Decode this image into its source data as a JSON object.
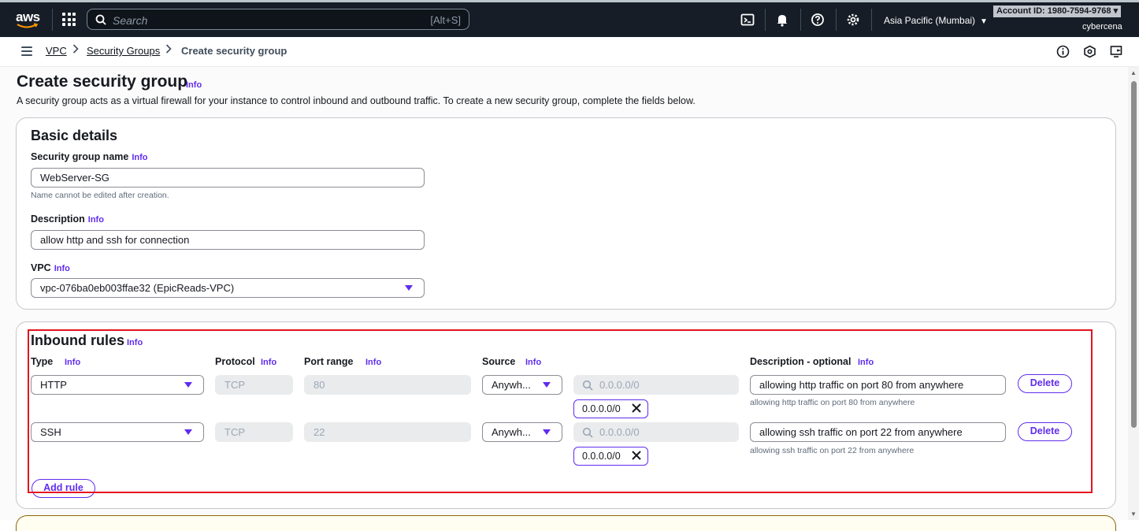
{
  "topnav": {
    "logo_text": "aws",
    "search_placeholder": "Search",
    "search_shortcut": "[Alt+S]",
    "region": "Asia Pacific (Mumbai)",
    "account": "Account ID: 1980-7594-9768 ▾",
    "user": "cybercena"
  },
  "breadcrumb": {
    "items": [
      "VPC",
      "Security Groups"
    ],
    "current": "Create security group"
  },
  "page": {
    "title": "Create security group",
    "info": "Info",
    "description": "A security group acts as a virtual firewall for your instance to control inbound and outbound traffic. To create a new security group, complete the fields below."
  },
  "basic": {
    "title": "Basic details",
    "name_label": "Security group name",
    "name_value": "WebServer-SG",
    "name_hint": "Name cannot be edited after creation.",
    "desc_label": "Description",
    "desc_value": "allow http and ssh for connection",
    "vpc_label": "VPC",
    "vpc_value": "vpc-076ba0eb003ffae32 (EpicReads-VPC)"
  },
  "inbound": {
    "title": "Inbound rules",
    "columns": {
      "type": "Type",
      "protocol": "Protocol",
      "port": "Port range",
      "source": "Source",
      "description": "Description - optional"
    },
    "rules": [
      {
        "type": "HTTP",
        "protocol": "TCP",
        "port": "80",
        "source": "Anywh...",
        "cidr_placeholder": "0.0.0.0/0",
        "token": "0.0.0.0/0",
        "description": "allowing http traffic on port 80 from anywhere",
        "description_hint": "allowing http traffic on port 80 from anywhere",
        "delete_label": "Delete"
      },
      {
        "type": "SSH",
        "protocol": "TCP",
        "port": "22",
        "source": "Anywh...",
        "cidr_placeholder": "0.0.0.0/0",
        "token": "0.0.0.0/0",
        "description": "allowing ssh traffic on port 22 from anywhere",
        "description_hint": "allowing ssh traffic on port 22 from anywhere",
        "delete_label": "Delete"
      }
    ],
    "add_rule_label": "Add rule"
  },
  "colors": {
    "nav_bg": "#161d26",
    "accent": "#5f2ced",
    "highlight_box": "#e3141f"
  }
}
